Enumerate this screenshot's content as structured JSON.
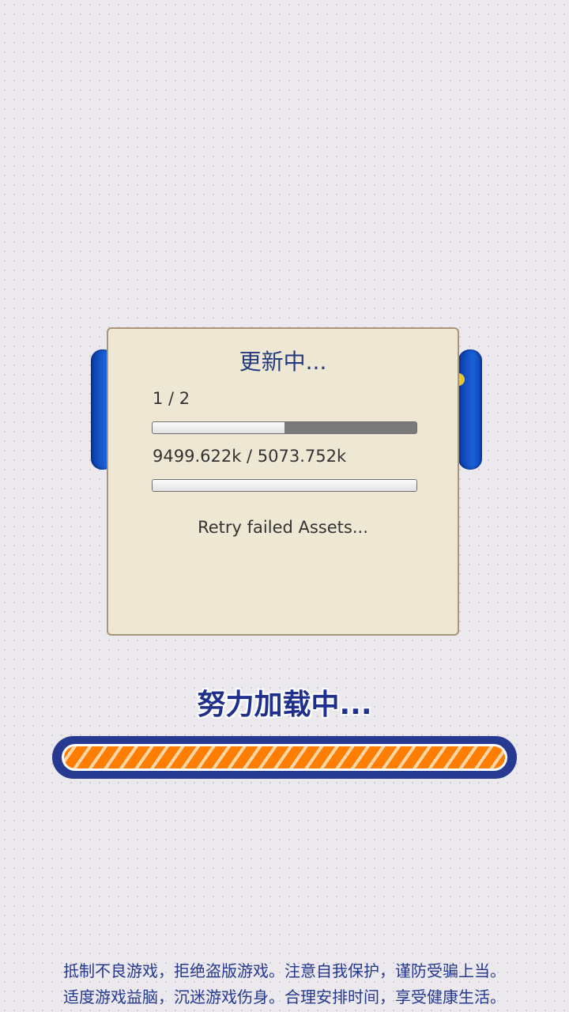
{
  "dialog": {
    "title": "更新中...",
    "file_count": "1 / 2",
    "file_progress": 0.5,
    "download_size": "9499.622k / 5073.752k",
    "download_progress": 1.0,
    "status": "Retry failed Assets..."
  },
  "loading": {
    "title": "努力加载中...",
    "progress": 1.0
  },
  "notice": {
    "line1": "抵制不良游戏，拒绝盗版游戏。注意自我保护，谨防受骗上当。",
    "line2": "适度游戏益脑，沉迷游戏伤身。合理安排时间，享受健康生活。"
  },
  "colors": {
    "dialog_background": "#ede7d3",
    "title_blue": "#233a7e",
    "loading_bar_frame": "#263a92",
    "loading_bar_fill": "#ff7d00"
  }
}
